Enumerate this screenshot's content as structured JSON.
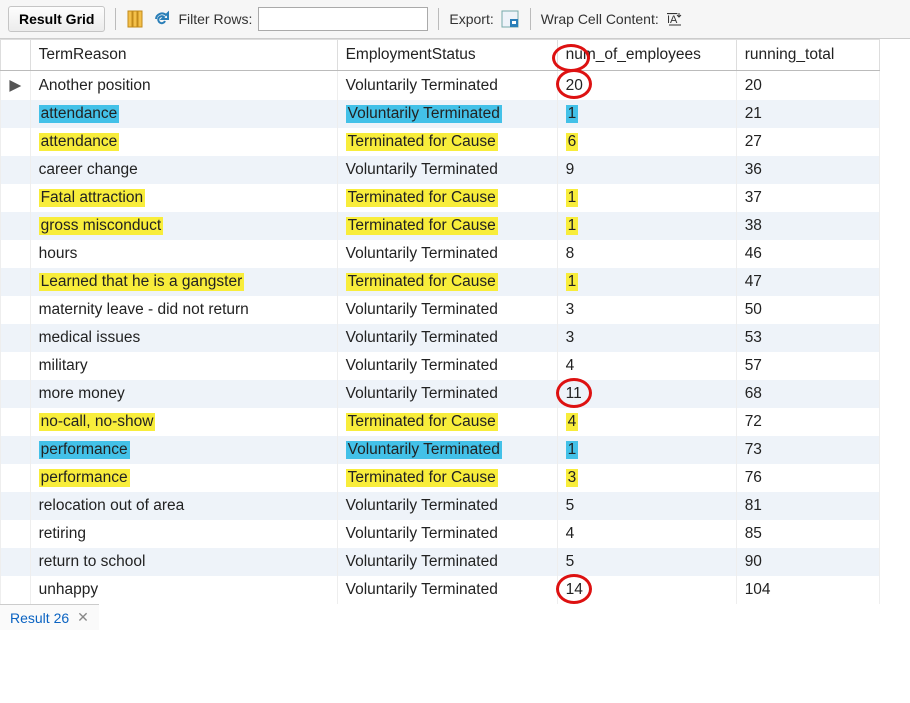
{
  "toolbar": {
    "result_grid_label": "Result Grid",
    "filter_label": "Filter Rows:",
    "filter_value": "",
    "export_label": "Export:",
    "wrap_label": "Wrap Cell Content:"
  },
  "columns": {
    "c1": "TermReason",
    "c2": "EmploymentStatus",
    "c3": "num_of_employees",
    "c4": "running_total"
  },
  "rows": [
    {
      "reason": "Another position",
      "status": "Voluntarily Terminated",
      "num": "20",
      "total": "20",
      "hl_reason": null,
      "hl_status": null,
      "hl_num": null,
      "circle_num": true
    },
    {
      "reason": "attendance",
      "status": "Voluntarily Terminated",
      "num": "1",
      "total": "21",
      "hl_reason": "cyan",
      "hl_status": "cyan",
      "hl_num": "cyan",
      "circle_num": false
    },
    {
      "reason": "attendance",
      "status": "Terminated for Cause",
      "num": "6",
      "total": "27",
      "hl_reason": "yellow",
      "hl_status": "yellow",
      "hl_num": "yellow",
      "circle_num": false
    },
    {
      "reason": "career change",
      "status": "Voluntarily Terminated",
      "num": "9",
      "total": "36",
      "hl_reason": null,
      "hl_status": null,
      "hl_num": null,
      "circle_num": false
    },
    {
      "reason": "Fatal attraction",
      "status": "Terminated for Cause",
      "num": "1",
      "total": "37",
      "hl_reason": "yellow",
      "hl_status": "yellow",
      "hl_num": "yellow",
      "circle_num": false
    },
    {
      "reason": "gross misconduct",
      "status": "Terminated for Cause",
      "num": "1",
      "total": "38",
      "hl_reason": "yellow",
      "hl_status": "yellow",
      "hl_num": "yellow",
      "circle_num": false
    },
    {
      "reason": "hours",
      "status": "Voluntarily Terminated",
      "num": "8",
      "total": "46",
      "hl_reason": null,
      "hl_status": null,
      "hl_num": null,
      "circle_num": false
    },
    {
      "reason": "Learned that he is a gangster",
      "status": "Terminated for Cause",
      "num": "1",
      "total": "47",
      "hl_reason": "yellow",
      "hl_status": "yellow",
      "hl_num": "yellow",
      "circle_num": false
    },
    {
      "reason": "maternity leave - did not return",
      "status": "Voluntarily Terminated",
      "num": "3",
      "total": "50",
      "hl_reason": null,
      "hl_status": null,
      "hl_num": null,
      "circle_num": false
    },
    {
      "reason": "medical issues",
      "status": "Voluntarily Terminated",
      "num": "3",
      "total": "53",
      "hl_reason": null,
      "hl_status": null,
      "hl_num": null,
      "circle_num": false
    },
    {
      "reason": "military",
      "status": "Voluntarily Terminated",
      "num": "4",
      "total": "57",
      "hl_reason": null,
      "hl_status": null,
      "hl_num": null,
      "circle_num": false
    },
    {
      "reason": "more money",
      "status": "Voluntarily Terminated",
      "num": "11",
      "total": "68",
      "hl_reason": null,
      "hl_status": null,
      "hl_num": null,
      "circle_num": true
    },
    {
      "reason": "no-call, no-show",
      "status": "Terminated for Cause",
      "num": "4",
      "total": "72",
      "hl_reason": "yellow",
      "hl_status": "yellow",
      "hl_num": "yellow",
      "circle_num": false
    },
    {
      "reason": "performance",
      "status": "Voluntarily Terminated",
      "num": "1",
      "total": "73",
      "hl_reason": "cyan",
      "hl_status": "cyan",
      "hl_num": "cyan",
      "circle_num": false
    },
    {
      "reason": "performance",
      "status": "Terminated for Cause",
      "num": "3",
      "total": "76",
      "hl_reason": "yellow",
      "hl_status": "yellow",
      "hl_num": "yellow",
      "circle_num": false
    },
    {
      "reason": "relocation out of area",
      "status": "Voluntarily Terminated",
      "num": "5",
      "total": "81",
      "hl_reason": null,
      "hl_status": null,
      "hl_num": null,
      "circle_num": false
    },
    {
      "reason": "retiring",
      "status": "Voluntarily Terminated",
      "num": "4",
      "total": "85",
      "hl_reason": null,
      "hl_status": null,
      "hl_num": null,
      "circle_num": false
    },
    {
      "reason": "return to school",
      "status": "Voluntarily Terminated",
      "num": "5",
      "total": "90",
      "hl_reason": null,
      "hl_status": null,
      "hl_num": null,
      "circle_num": false
    },
    {
      "reason": "unhappy",
      "status": "Voluntarily Terminated",
      "num": "14",
      "total": "104",
      "hl_reason": null,
      "hl_status": null,
      "hl_num": null,
      "circle_num": true
    }
  ],
  "status_tab": {
    "label": "Result 26"
  }
}
